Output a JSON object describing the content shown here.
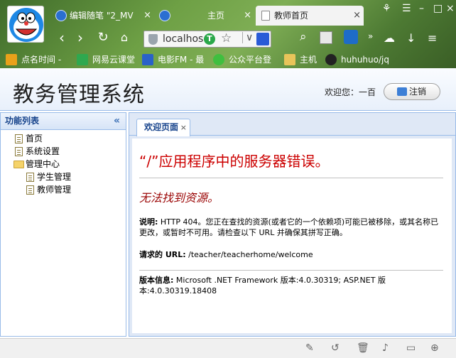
{
  "browser": {
    "tabs": [
      {
        "label": "编辑随笔 \"2_MV",
        "active": false
      },
      {
        "label": "主页",
        "active": false
      },
      {
        "label": "教师首页",
        "active": true
      }
    ],
    "address": "localhos",
    "bookmarks": [
      {
        "label": "点名时间 -",
        "icon": "points-icon",
        "color": "#e9a11a"
      },
      {
        "label": "网易云课堂",
        "icon": "netease-icon",
        "color": "#2fa84f"
      },
      {
        "label": "电影FM - 最",
        "icon": "fm-icon",
        "color": "#2a62c9"
      },
      {
        "label": "公众平台登",
        "icon": "wechat-icon",
        "color": "#3fbf3f"
      },
      {
        "label": "主机",
        "icon": "folder-icon",
        "color": "#e8c45a"
      },
      {
        "label": "huhuhuo/jq",
        "icon": "github-icon",
        "color": "#222222"
      }
    ]
  },
  "app": {
    "title": "教务管理系统",
    "welcome": "欢迎您：一百",
    "logout_label": "注销"
  },
  "sidebar": {
    "title": "功能列表",
    "items": [
      {
        "label": "首页",
        "level": 0,
        "type": "file"
      },
      {
        "label": "系统设置",
        "level": 0,
        "type": "file"
      },
      {
        "label": "管理中心",
        "level": 0,
        "type": "folder"
      },
      {
        "label": "学生管理",
        "level": 1,
        "type": "file"
      },
      {
        "label": "教师管理",
        "level": 1,
        "type": "file"
      }
    ]
  },
  "main": {
    "tab_label": "欢迎页面",
    "error": {
      "title": "“/”应用程序中的服务器错误。",
      "subtitle": "无法找到资源。",
      "desc_label": "说明:",
      "desc_text": " HTTP 404。您正在查找的资源(或者它的一个依赖项)可能已被移除，或其名称已更改，或暂时不可用。请检查以下 URL 并确保其拼写正确。",
      "url_label": "请求的 URL:",
      "url_text": " /teacher/teacherhome/welcome",
      "version_label": "版本信息:",
      "version_text": " Microsoft .NET Framework 版本:4.0.30319; ASP.NET 版本:4.0.30319.18408"
    }
  }
}
